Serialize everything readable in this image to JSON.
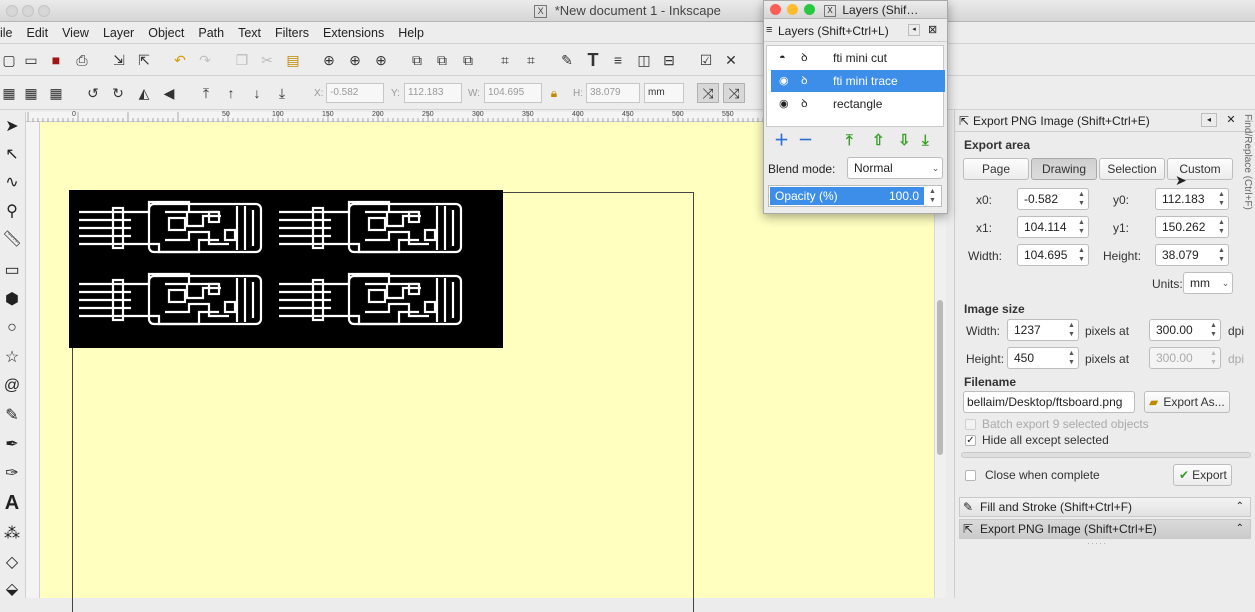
{
  "window": {
    "title": "*New document 1 - Inkscape"
  },
  "menu": [
    "ile",
    "Edit",
    "View",
    "Layer",
    "Object",
    "Path",
    "Text",
    "Filters",
    "Extensions",
    "Help"
  ],
  "coords": {
    "x_label": "X:",
    "x_value": "-0.582",
    "y_label": "Y:",
    "y_value": "112.183",
    "w_label": "W:",
    "w_value": "104.695",
    "h_label": "H:",
    "h_value": "38.079",
    "unit": "mm"
  },
  "ruler_labels": [
    "0",
    "50",
    "100",
    "150",
    "200",
    "250",
    "300",
    "350",
    "400",
    "450",
    "500",
    "550"
  ],
  "layers_dialog": {
    "title": "Layers (Shif…",
    "tab_label": "Layers (Shift+Ctrl+L)",
    "items": [
      {
        "name": "fti mini cut",
        "selected": false
      },
      {
        "name": "fti mini trace",
        "selected": true
      },
      {
        "name": "rectangle",
        "selected": false
      }
    ],
    "blend_label": "Blend mode:",
    "blend_value": "Normal",
    "opacity_label": "Opacity (%)",
    "opacity_value": "100.0"
  },
  "export_panel": {
    "header": "Export PNG Image (Shift+Ctrl+E)",
    "area_title": "Export area",
    "area_buttons": [
      "Page",
      "Drawing",
      "Selection",
      "Custom"
    ],
    "active_area": "Drawing",
    "x0_label": "x0:",
    "x0": "-0.582",
    "y0_label": "y0:",
    "y0": "112.183",
    "x1_label": "x1:",
    "x1": "104.114",
    "y1_label": "y1:",
    "y1": "150.262",
    "width_label": "Width:",
    "width": "104.695",
    "height_label": "Height:",
    "height": "38.079",
    "units_label": "Units:",
    "units": "mm",
    "image_size_title": "Image size",
    "img_width_label": "Width:",
    "img_width": "1237",
    "img_height_label": "Height:",
    "img_height": "450",
    "pixels_at": "pixels at",
    "dpi": "300.00",
    "dpi_label": "dpi",
    "filename_title": "Filename",
    "filename": "bellaim/Desktop/ftsboard.png",
    "export_as": "Export As...",
    "batch_label": "Batch export 9 selected objects",
    "hide_label": "Hide all except selected",
    "close_label": "Close when complete",
    "export_button": "Export"
  },
  "dock_tabs": [
    "Fill and Stroke (Shift+Ctrl+F)",
    "Export PNG Image (Shift+Ctrl+E)"
  ],
  "side_tab": "Find/Replace (Ctrl+F)",
  "colors": {
    "canvas": "#ffffc0",
    "selection": "#3d8ee8"
  }
}
